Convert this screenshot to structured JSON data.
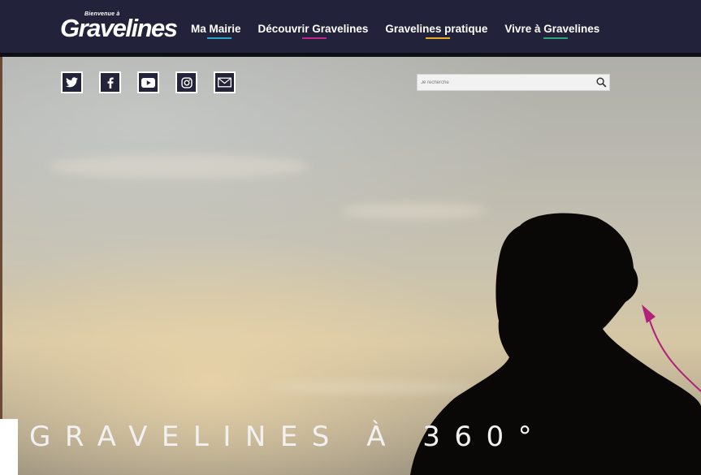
{
  "logo": {
    "top": "Bienvenue à",
    "main": "Gravelines"
  },
  "nav": [
    {
      "label": "Ma Mairie",
      "color": "#2aa7c9"
    },
    {
      "label": "Découvrir Gravelines",
      "color": "#c2258e"
    },
    {
      "label": "Gravelines pratique",
      "color": "#e7a928"
    },
    {
      "label": "Vivre à Gravelines",
      "color": "#2fa37c"
    }
  ],
  "social": [
    "twitter-icon",
    "facebook-icon",
    "youtube-icon",
    "instagram-icon",
    "mail-icon"
  ],
  "search": {
    "placeholder": "Je recherche"
  },
  "hero": {
    "title": "GRAVELINES À 360°"
  },
  "colors": {
    "topbar": "#22233a",
    "arrow": "#b1207a"
  }
}
